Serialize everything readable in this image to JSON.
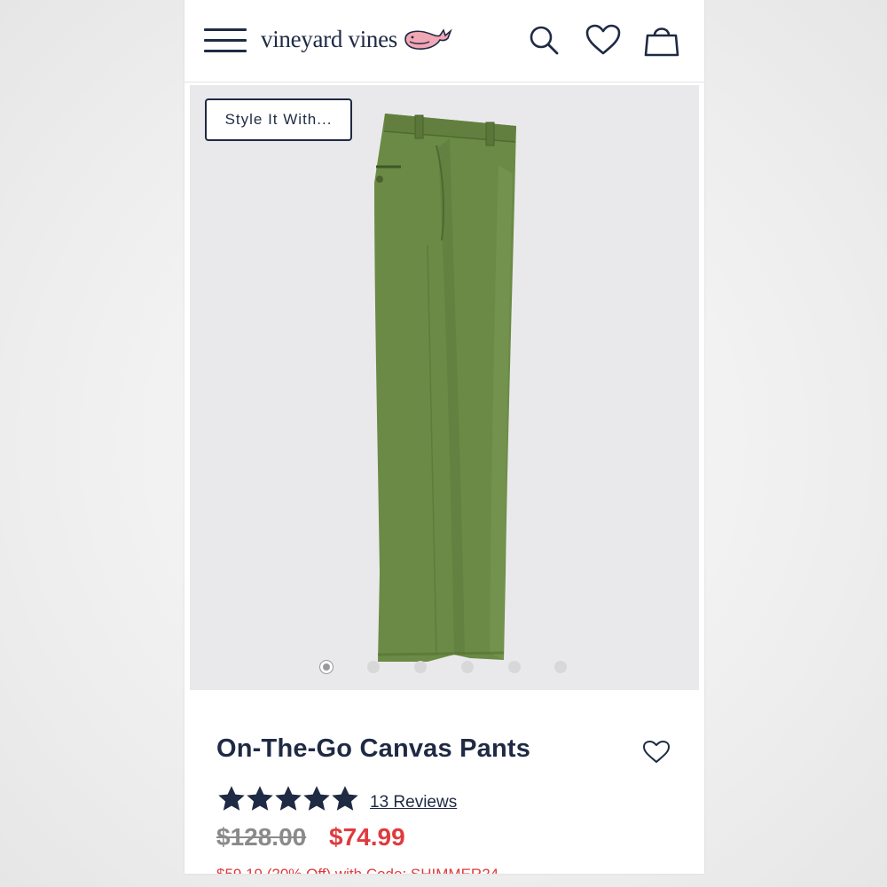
{
  "header": {
    "logo_text": "vineyard vines",
    "icons": [
      "menu-icon",
      "search-icon",
      "heart-icon",
      "shopping-bag-icon"
    ]
  },
  "gallery": {
    "style_button_label": "Style It With...",
    "image_count": 6,
    "active_index": 0
  },
  "product": {
    "title": "On-The-Go Canvas Pants",
    "rating": 5,
    "reviews_label": "13 Reviews",
    "original_price": "$128.00",
    "sale_price": "$74.99",
    "promo_partial": "$59.19 (20% Off) with Code: SHIMMER24"
  },
  "colors": {
    "navy": "#1f2a44",
    "sale_red": "#e03a3e",
    "pants_green": "#6b8a46",
    "gallery_bg": "#e9e9eb"
  }
}
